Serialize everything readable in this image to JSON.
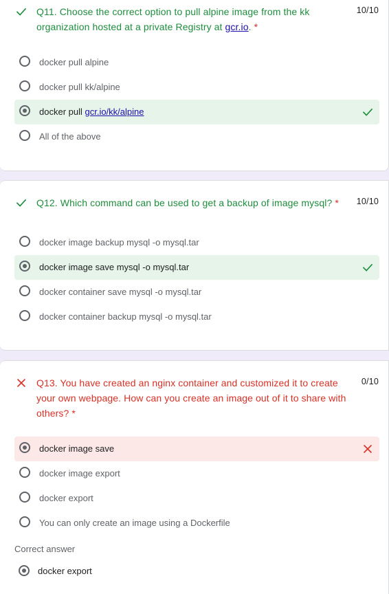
{
  "questions": [
    {
      "number": "Q11.",
      "text_before": "Choose the correct option to pull alpine image from the kk organization hosted at a private Registry at ",
      "link_text": "gcr.io",
      "text_after": ".",
      "required_mark": "*",
      "score": "10/10",
      "result": "correct",
      "options": [
        {
          "label": "docker pull alpine",
          "selected": false
        },
        {
          "label": "docker pull kk/alpine",
          "selected": false
        },
        {
          "label_prefix": "docker pull ",
          "label_link": "gcr.io/kk/alpine",
          "selected": true,
          "result": "correct"
        },
        {
          "label": "All of the above",
          "selected": false
        }
      ]
    },
    {
      "number": "Q12.",
      "text": "Which command can be used to get a backup of image mysql?",
      "required_mark": "*",
      "score": "10/10",
      "result": "correct",
      "options": [
        {
          "label": "docker image backup mysql -o mysql.tar",
          "selected": false
        },
        {
          "label": "docker image save mysql -o mysql.tar",
          "selected": true,
          "result": "correct"
        },
        {
          "label": "docker container save mysql -o mysql.tar",
          "selected": false
        },
        {
          "label": "docker container backup mysql -o mysql.tar",
          "selected": false
        }
      ]
    },
    {
      "number": "Q13.",
      "text": "You have created an nginx container and customized it to create your own webpage. How can you create an image out of it to share with others?",
      "required_mark": "*",
      "score": "0/10",
      "result": "incorrect",
      "options": [
        {
          "label": "docker image save",
          "selected": true,
          "result": "incorrect"
        },
        {
          "label": "docker image export",
          "selected": false
        },
        {
          "label": "docker export",
          "selected": false
        },
        {
          "label": "You can only create an image using a Dockerfile",
          "selected": false
        }
      ],
      "correct_answer_title": "Correct answer",
      "correct_answer": "docker export"
    }
  ],
  "colors": {
    "correct": "#1e8e3e",
    "incorrect": "#d93025",
    "correct_bg": "#e6f4ea",
    "incorrect_bg": "#fce8e6",
    "page_bg": "#f0ebf8",
    "link": "#1a0dab"
  },
  "icons": {
    "correct": "check-icon",
    "incorrect": "cross-icon"
  }
}
